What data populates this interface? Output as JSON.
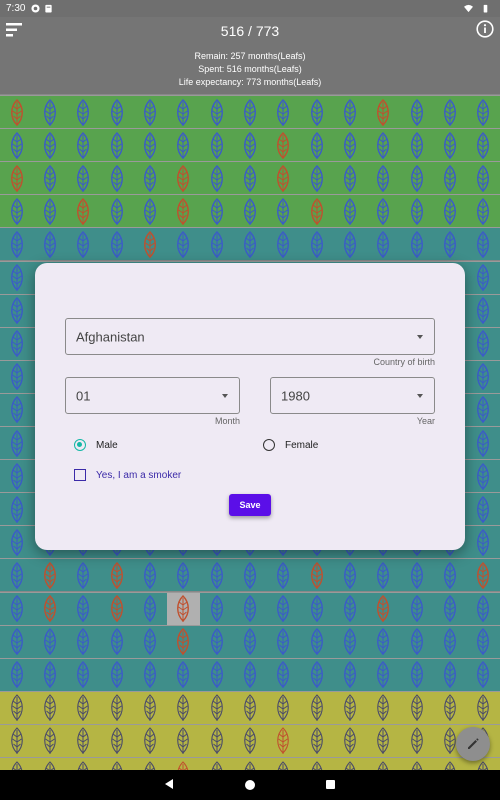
{
  "status_bar": {
    "time": "7:30"
  },
  "header": {
    "title": "516 / 773",
    "remain": "Remain: 257 months(Leafs)",
    "spent": "Spent: 516 months(Leafs)",
    "life_expectancy": "Life expectancy: 773 months(Leafs)"
  },
  "dialog": {
    "country": {
      "value": "Afghanistan",
      "helper": "Country of birth"
    },
    "month": {
      "value": "01",
      "helper": "Month"
    },
    "year": {
      "value": "1980",
      "helper": "Year"
    },
    "gender": {
      "male_label": "Male",
      "female_label": "Female",
      "selected": "Male"
    },
    "smoker": {
      "label": "Yes, I am a smoker",
      "checked": false
    },
    "save_label": "Save"
  },
  "colors": {
    "spent_green": "#58a34e",
    "spent_teal": "#3f8e8a",
    "remain_yellow": "#b5b544",
    "leaf_blue": "#3b5bc8",
    "leaf_red": "#c0502e",
    "accent_purple": "#5b0fe8",
    "radio_teal": "#14b8a6"
  }
}
